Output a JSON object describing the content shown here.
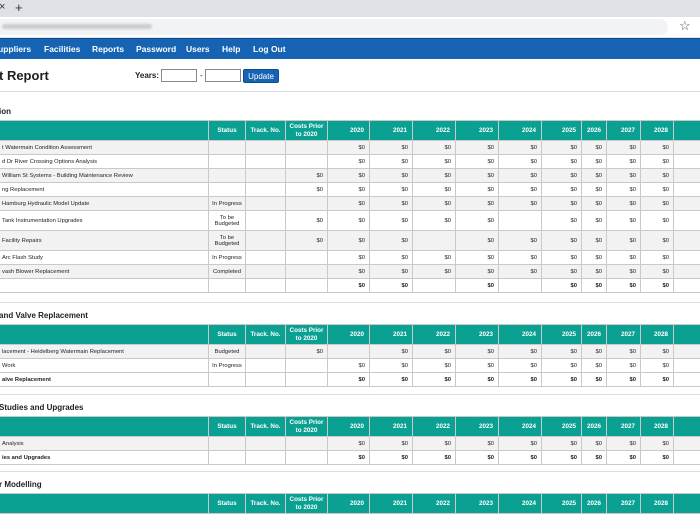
{
  "browser": {
    "close_glyph": "×",
    "new_tab_glyph": "+",
    "bookmark_icon": "star-icon"
  },
  "nav": [
    "uppliers",
    "Facilities",
    "Reports",
    "Password",
    "Users",
    "Help",
    "Log Out"
  ],
  "page": {
    "title": "t Report",
    "years_label": "Years:",
    "dash": "-",
    "update_label": "Update",
    "year_from": "",
    "year_to": ""
  },
  "columns": {
    "status": "Status",
    "track": "Track. No.",
    "prior_a": "Costs Prior",
    "prior_b": "to 2020",
    "years": [
      "2020",
      "2021",
      "2022",
      "2023",
      "2024",
      "2025",
      "2026",
      "2027",
      "2028"
    ]
  },
  "sections": [
    {
      "title": "ion",
      "rows": [
        {
          "name": "t Watermain Condition Assessment",
          "status": "",
          "track": "",
          "prior": "",
          "v": [
            "$0",
            "$0",
            "$0",
            "$0",
            "$0",
            "$0",
            "$0",
            "$0",
            "$0"
          ]
        },
        {
          "name": "d Dr River Crossing Options Analysis",
          "status": "",
          "track": "",
          "prior": "",
          "v": [
            "$0",
            "$0",
            "$0",
            "$0",
            "$0",
            "$0",
            "$0",
            "$0",
            "$0"
          ]
        },
        {
          "name": "William St Systems - Building Maintenance Review",
          "status": "",
          "track": "",
          "prior": "$0",
          "v": [
            "$0",
            "$0",
            "$0",
            "$0",
            "$0",
            "$0",
            "$0",
            "$0",
            "$0"
          ]
        },
        {
          "name": "ng Replacement",
          "status": "",
          "track": "",
          "prior": "$0",
          "v": [
            "$0",
            "$0",
            "$0",
            "$0",
            "$0",
            "$0",
            "$0",
            "$0",
            "$0"
          ]
        },
        {
          "name": "Hamburg Hydraulic Model Update",
          "status": "In Progress",
          "track": "",
          "prior": "",
          "v": [
            "$0",
            "$0",
            "$0",
            "$0",
            "$0",
            "$0",
            "$0",
            "$0",
            "$0"
          ]
        },
        {
          "name": "Tank Instrumentation Upgrades",
          "status": "To be|Budgeted",
          "track": "",
          "prior": "$0",
          "v": [
            "$0",
            "$0",
            "$0",
            "$0",
            "",
            "$0",
            "$0",
            "$0",
            "$0"
          ]
        },
        {
          "name": "Facility Repairs",
          "status": "To be|Budgeted",
          "track": "",
          "prior": "$0",
          "v": [
            "$0",
            "$0",
            "",
            "$0",
            "$0",
            "$0",
            "$0",
            "$0",
            "$0"
          ]
        },
        {
          "name": "Arc Flash Study",
          "status": "In Progress",
          "track": "",
          "prior": "",
          "v": [
            "$0",
            "$0",
            "$0",
            "$0",
            "$0",
            "$0",
            "$0",
            "$0",
            "$0"
          ]
        },
        {
          "name": "vash Blower Replacement",
          "status": "Completed",
          "track": "",
          "prior": "",
          "v": [
            "$0",
            "$0",
            "$0",
            "$0",
            "$0",
            "$0",
            "$0",
            "$0",
            "$0"
          ]
        }
      ],
      "total": {
        "name": "",
        "v": [
          "$0",
          "$0",
          "",
          "$0",
          "",
          "$0",
          "$0",
          "$0",
          "$0"
        ]
      }
    },
    {
      "title": "and Valve Replacement",
      "rows": [
        {
          "name": "lacement - Heidelberg Watermain Replacement",
          "status": "Budgeted",
          "track": "",
          "prior": "$0",
          "v": [
            "",
            "$0",
            "$0",
            "$0",
            "$0",
            "$0",
            "$0",
            "$0",
            "$0"
          ]
        },
        {
          "name": "Work",
          "status": "In Progress",
          "track": "",
          "prior": "",
          "v": [
            "$0",
            "$0",
            "$0",
            "$0",
            "$0",
            "$0",
            "$0",
            "$0",
            "$0"
          ]
        }
      ],
      "total": {
        "name": "alve Replacement",
        "v": [
          "$0",
          "$0",
          "$0",
          "$0",
          "$0",
          "$0",
          "$0",
          "$0",
          "$0"
        ]
      }
    },
    {
      "title": "Studies and Upgrades",
      "rows": [
        {
          "name": "Analysis",
          "status": "",
          "track": "",
          "prior": "",
          "v": [
            "$0",
            "$0",
            "$0",
            "$0",
            "$0",
            "$0",
            "$0",
            "$0",
            "$0"
          ]
        }
      ],
      "total": {
        "name": "ies and Upgrades",
        "v": [
          "$0",
          "$0",
          "$0",
          "$0",
          "$0",
          "$0",
          "$0",
          "$0",
          "$0"
        ]
      }
    },
    {
      "title": "r Modelling",
      "rows": [],
      "total": null
    }
  ]
}
